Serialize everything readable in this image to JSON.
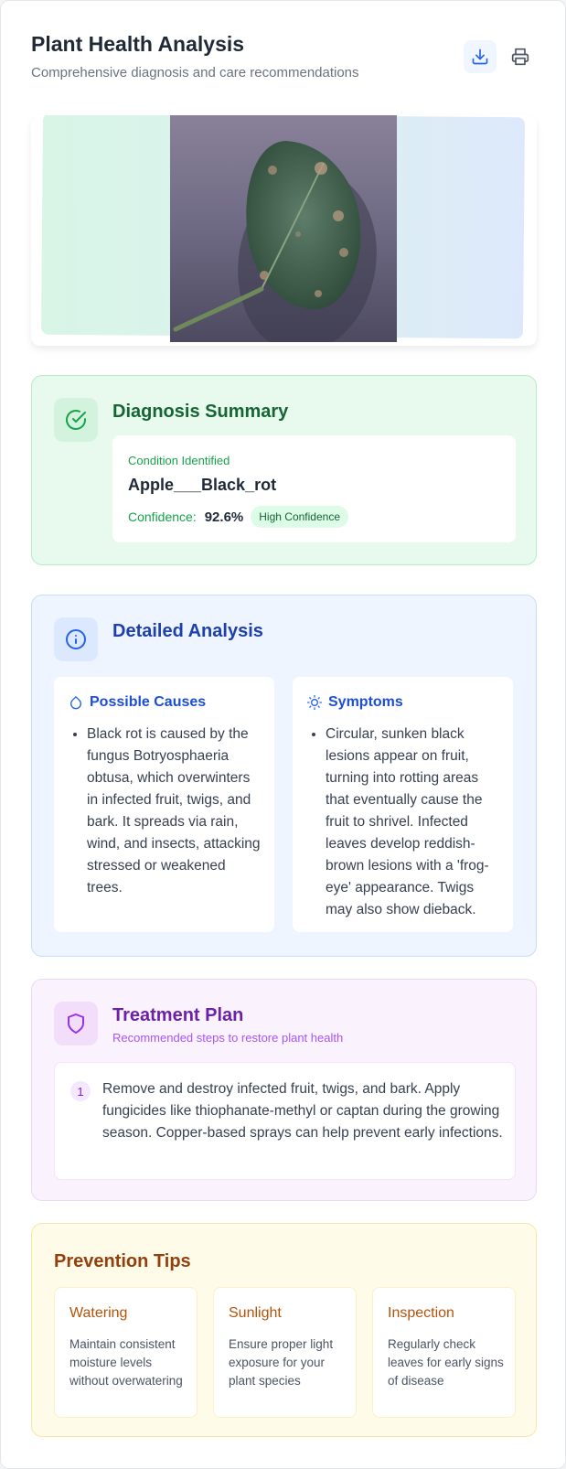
{
  "header": {
    "title": "Plant Health Analysis",
    "subtitle": "Comprehensive diagnosis and care recommendations",
    "download_icon": "download-icon",
    "print_icon": "printer-icon"
  },
  "diagnosis": {
    "title": "Diagnosis Summary",
    "icon": "check-circle-icon",
    "condition_label": "Condition Identified",
    "condition_name": "Apple___Black_rot",
    "confidence_label": "Confidence:",
    "confidence_value": "92.6%",
    "confidence_badge": "High Confidence"
  },
  "analysis": {
    "title": "Detailed Analysis",
    "icon": "info-icon",
    "causes": {
      "title": "Possible Causes",
      "icon": "droplet-icon",
      "items": [
        "Black rot is caused by the fungus Botryosphaeria obtusa, which overwinters in infected fruit, twigs, and bark. It spreads via rain, wind, and insects, attacking stressed or weakened trees."
      ]
    },
    "symptoms": {
      "title": "Symptoms",
      "icon": "sun-icon",
      "items": [
        "Circular, sunken black lesions appear on fruit, turning into rotting areas that eventually cause the fruit to shrivel. Infected leaves develop reddish-brown lesions with a 'frog-eye' appearance. Twigs may also show dieback."
      ]
    }
  },
  "treatment": {
    "title": "Treatment Plan",
    "subtitle": "Recommended steps to restore plant health",
    "icon": "shield-icon",
    "steps": [
      {
        "number": "1",
        "text": "Remove and destroy infected fruit, twigs, and bark. Apply fungicides like thiophanate-methyl or captan during the growing season. Copper-based sprays can help prevent early infections."
      }
    ]
  },
  "prevention": {
    "title": "Prevention Tips",
    "tips": [
      {
        "title": "Watering",
        "text": "Maintain consistent moisture levels without overwatering"
      },
      {
        "title": "Sunlight",
        "text": "Ensure proper light exposure for your plant species"
      },
      {
        "title": "Inspection",
        "text": "Regularly check leaves for early signs of disease"
      }
    ]
  },
  "colors": {
    "diagnosis_accent": "#16a34a",
    "analysis_accent": "#2563eb",
    "treatment_accent": "#9333ea",
    "prevention_accent": "#b45309"
  }
}
